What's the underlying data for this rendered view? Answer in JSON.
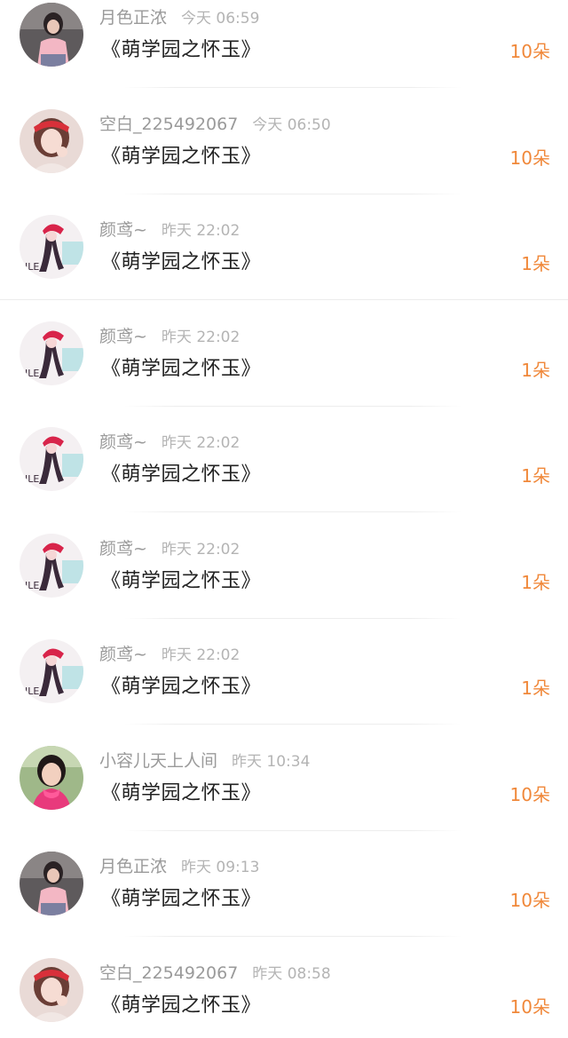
{
  "colors": {
    "name": "#9a9a9a",
    "time": "#b4b4b4",
    "gift_title": "#222222",
    "amount": "#f0883a",
    "divider": "#ececec"
  },
  "rows": [
    {
      "name": "月色正浓",
      "time": "今天 06:59",
      "gift": "《萌学园之怀玉》",
      "amount": "10朵",
      "avatar_icon": "woman-pink-shirt-avatar"
    },
    {
      "name": "空白_225492067",
      "time": "今天 06:50",
      "gift": "《萌学园之怀玉》",
      "amount": "10朵",
      "avatar_icon": "girl-red-headband-avatar"
    },
    {
      "name": "颜鸢~",
      "time": "昨天 22:02",
      "gift": "《萌学园之怀玉》",
      "amount": "1朵",
      "avatar_icon": "anime-girl-red-cap-avatar"
    },
    {
      "name": "颜鸢~",
      "time": "昨天 22:02",
      "gift": "《萌学园之怀玉》",
      "amount": "1朵",
      "avatar_icon": "anime-girl-red-cap-avatar"
    },
    {
      "name": "颜鸢~",
      "time": "昨天 22:02",
      "gift": "《萌学园之怀玉》",
      "amount": "1朵",
      "avatar_icon": "anime-girl-red-cap-avatar"
    },
    {
      "name": "颜鸢~",
      "time": "昨天 22:02",
      "gift": "《萌学园之怀玉》",
      "amount": "1朵",
      "avatar_icon": "anime-girl-red-cap-avatar"
    },
    {
      "name": "颜鸢~",
      "time": "昨天 22:02",
      "gift": "《萌学园之怀玉》",
      "amount": "1朵",
      "avatar_icon": "anime-girl-red-cap-avatar"
    },
    {
      "name": "小容儿天上人间",
      "time": "昨天 10:34",
      "gift": "《萌学园之怀玉》",
      "amount": "10朵",
      "avatar_icon": "woman-pink-scarf-avatar"
    },
    {
      "name": "月色正浓",
      "time": "昨天 09:13",
      "gift": "《萌学园之怀玉》",
      "amount": "10朵",
      "avatar_icon": "woman-pink-shirt-avatar"
    },
    {
      "name": "空白_225492067",
      "time": "昨天 08:58",
      "gift": "《萌学园之怀玉》",
      "amount": "10朵",
      "avatar_icon": "girl-red-headband-avatar"
    }
  ]
}
